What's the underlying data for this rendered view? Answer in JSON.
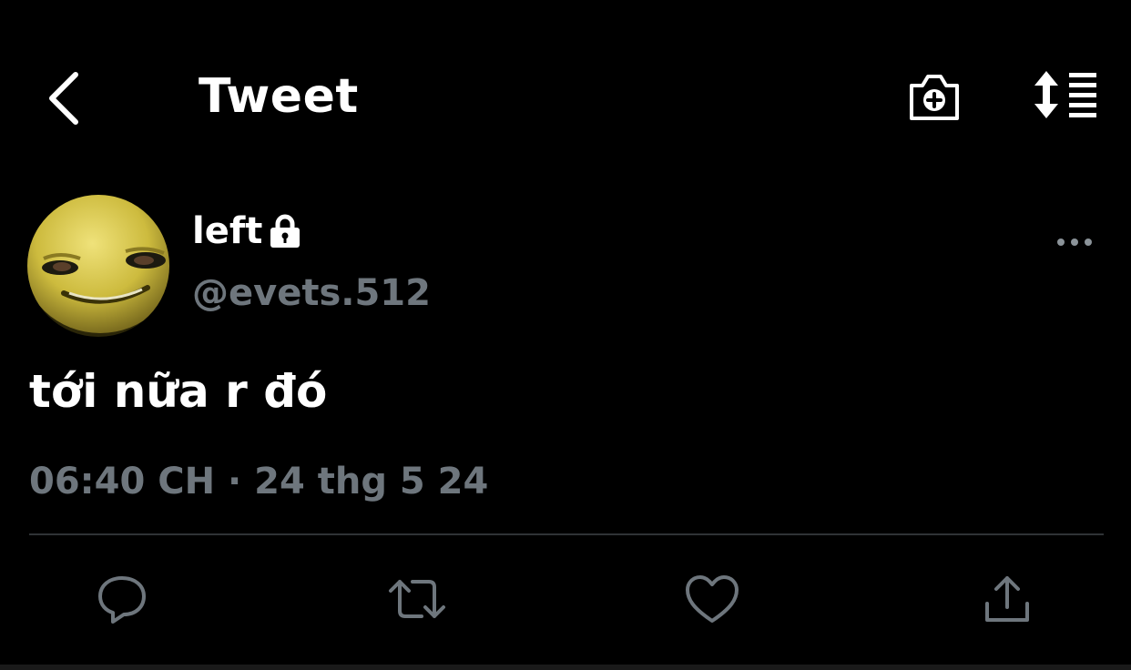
{
  "header": {
    "title": "Tweet",
    "back_icon": "chevron-left-icon",
    "add_media_icon": "camera-plus-icon",
    "sort_icon": "sort-replies-icon"
  },
  "tweet": {
    "author": {
      "display_name": "left",
      "handle": "@evets.512",
      "protected": true,
      "avatar_description": "yellow smiling face avatar"
    },
    "text": "tới nữa r đó",
    "timestamp": "06:40 CH · 24 thg 5 24"
  },
  "actions": [
    {
      "name": "reply",
      "icon": "reply-icon"
    },
    {
      "name": "retweet",
      "icon": "retweet-icon"
    },
    {
      "name": "like",
      "icon": "heart-icon"
    },
    {
      "name": "share",
      "icon": "share-icon"
    }
  ],
  "colors": {
    "background": "#000000",
    "primary_text": "#ffffff",
    "secondary_text": "#6e767d",
    "icon_gray": "#6e767d",
    "divider": "#2f3336"
  }
}
